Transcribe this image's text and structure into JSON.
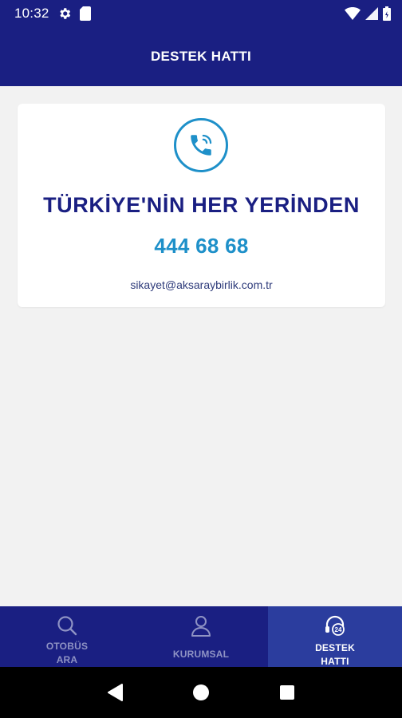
{
  "status_bar": {
    "time": "10:32",
    "icons": [
      "gear-icon",
      "sd-card-icon",
      "wifi-icon",
      "signal-icon",
      "battery-icon"
    ]
  },
  "app_bar": {
    "title": "DESTEK HATTI"
  },
  "support_card": {
    "icon": "phone-ringing-icon",
    "headline": "TÜRKİYE'NİN HER YERİNDEN",
    "phone": "444 68 68",
    "email": "sikayet@aksaraybirlik.com.tr"
  },
  "bottom_nav": {
    "items": [
      {
        "label": "OTOBÜS\nARA",
        "icon": "search-icon",
        "active": false
      },
      {
        "label": "KURUMSAL",
        "icon": "user-icon",
        "active": false
      },
      {
        "label": "DESTEK\nHATTI",
        "icon": "support-24-icon",
        "active": true
      }
    ]
  },
  "colors": {
    "primary": "#1a1f82",
    "active_tab": "#2b3d9e",
    "accent": "#1e90c9",
    "background": "#f2f2f2"
  }
}
